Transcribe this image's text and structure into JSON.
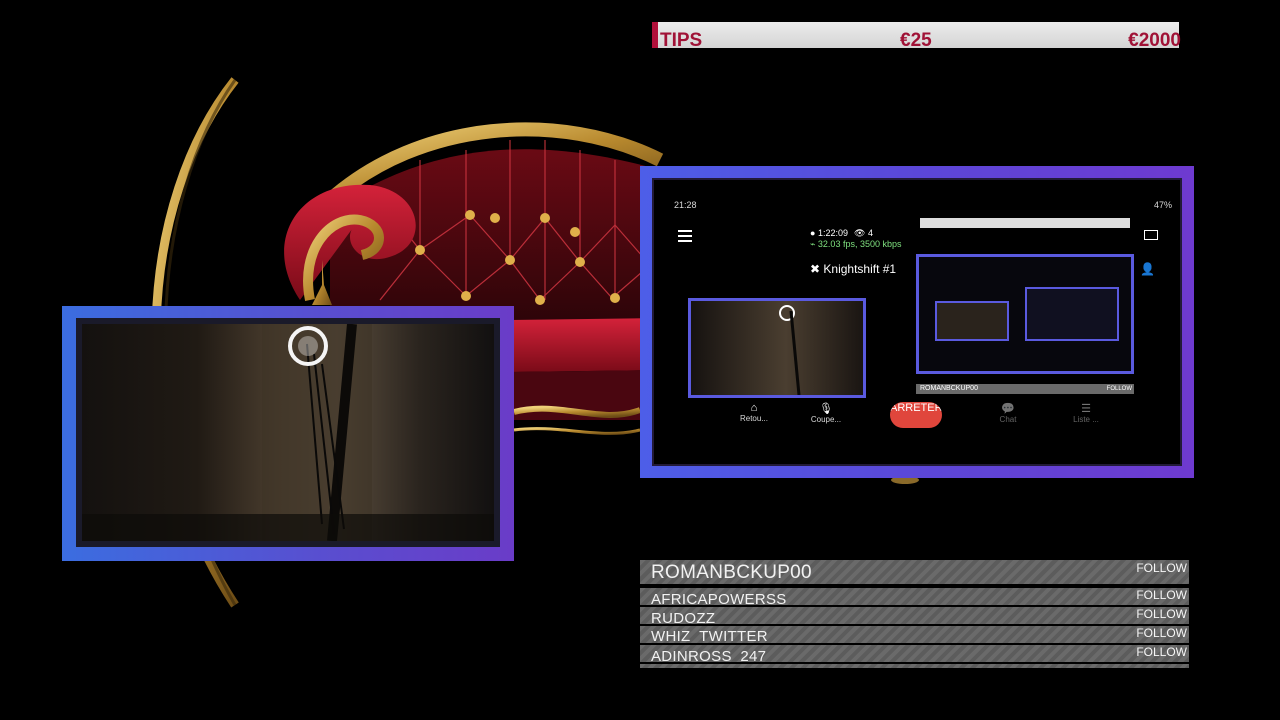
{
  "tips": {
    "label": "TIPS",
    "current": "€25",
    "goal": "€2000",
    "accent": "#b0103a"
  },
  "screen": {
    "time": "21:28",
    "battery": "47%",
    "live_timer": "1:22:09",
    "viewers": "4",
    "stream_stats": "32.03 fps, 3500 kbps",
    "stream_title": "Knightshift #1",
    "actions": {
      "return_label": "Retou...",
      "mute_label": "Coupe...",
      "stop_label": "ARRETER",
      "chat_label": "Chat",
      "list_label": "Liste ..."
    },
    "mini_follower": "ROMANBCKUP00",
    "mini_follow": "FOLLOW"
  },
  "followers": {
    "items": [
      {
        "name": "ROMANBCKUP00",
        "action": "FOLLOW"
      },
      {
        "name": "AFRICAPOWERSS",
        "action": "FOLLOW"
      },
      {
        "name": "RUDOZZ",
        "action": "FOLLOW"
      },
      {
        "name": "WHIZ_TWITTER",
        "action": "FOLLOW"
      },
      {
        "name": "ADINROSS_247",
        "action": "FOLLOW"
      }
    ]
  },
  "colors": {
    "frame_blue": "#4d5ee8",
    "frame_purple": "#6e3ad0",
    "sofa_red": "#b3122b",
    "sofa_gold": "#c9a34a",
    "stop_red": "#e0463c"
  },
  "icons": [
    "menu-icon",
    "eye-icon",
    "wifi-icon",
    "return-icon",
    "microphone-icon",
    "chat-icon",
    "list-icon",
    "screen-icon",
    "add-user-icon"
  ]
}
